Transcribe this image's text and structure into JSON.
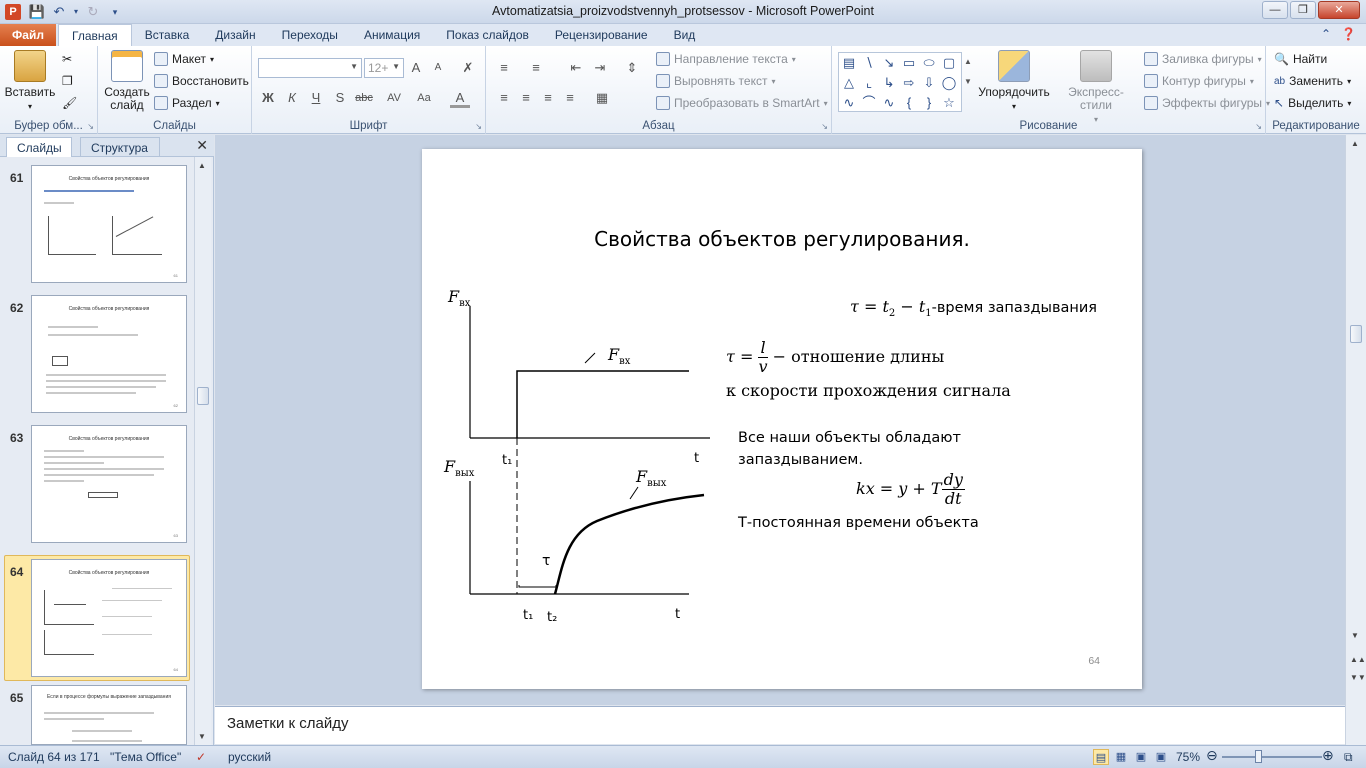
{
  "window": {
    "app_icon": "P",
    "title": "Avtomatizatsia_proizvodstvennyh_protsessov  -  Microsoft PowerPoint",
    "controls": [
      "minimize-icon",
      "restore-icon",
      "close-icon"
    ]
  },
  "ribbon_tabs": {
    "file": "Файл",
    "tabs": [
      "Главная",
      "Вставка",
      "Дизайн",
      "Переходы",
      "Анимация",
      "Показ слайдов",
      "Рецензирование",
      "Вид"
    ],
    "active": "Главная"
  },
  "ribbon": {
    "clipboard": {
      "paste": "Вставить",
      "label": "Буфер обм..."
    },
    "slides": {
      "new_slide": "Создать слайд",
      "layout": "Макет",
      "reset": "Восстановить",
      "section": "Раздел",
      "label": "Слайды"
    },
    "font": {
      "font_name": "",
      "font_size": "12+",
      "bold": "Ж",
      "italic": "К",
      "underline": "Ч",
      "shadow": "S",
      "strike": "abc",
      "spacing": "AV",
      "case": "Aa",
      "color": "A",
      "grow": "A",
      "shrink": "A",
      "label": "Шрифт"
    },
    "paragraph": {
      "text_direction": "Направление текста",
      "align_text": "Выровнять текст",
      "smartart": "Преобразовать в SmartArt",
      "label": "Абзац"
    },
    "drawing": {
      "arrange": "Упорядочить",
      "quick_styles": "Экспресс-стили",
      "fill": "Заливка фигуры",
      "outline": "Контур фигуры",
      "effects": "Эффекты фигуры",
      "label": "Рисование"
    },
    "editing": {
      "find": "Найти",
      "replace": "Заменить",
      "select": "Выделить",
      "label": "Редактирование"
    }
  },
  "left_pane": {
    "tabs": [
      "Слайды",
      "Структура"
    ],
    "active_tab": "Слайды",
    "thumbnails": [
      {
        "number": "61",
        "title": "Свойства объектов регулирования"
      },
      {
        "number": "62",
        "title": "Свойства объектов регулирования"
      },
      {
        "number": "63",
        "title": "Свойства объектов регулирования"
      },
      {
        "number": "64",
        "title": "Свойства объектов регулирования"
      },
      {
        "number": "65",
        "title": "Если в процессе формулы выражение запаздывания"
      }
    ],
    "selected": "64"
  },
  "slide": {
    "title": "Свойства объектов регулирования.",
    "graph_labels": {
      "f_in_axis": "F",
      "f_in_sub": "вх",
      "f_in_curve": "F",
      "f_in_curve_sub": "вх",
      "f_out_axis": "F",
      "f_out_sub": "вых",
      "f_out_curve": "F",
      "f_out_curve_sub": "вых",
      "t1_top": "t₁",
      "t_top": "t",
      "tau": "τ",
      "t1_bottom": "t₁",
      "t2_bottom": "t₂",
      "t_bottom": "t"
    },
    "formula1_text": "-время запаздывания",
    "formula2_text": "отношение длины",
    "formula2_line2": "к скорости прохождения сигнала",
    "text_delay_1": "Все наши объекты обладают",
    "text_delay_2": "запаздыванием.",
    "text_constant": "Т-постоянная времени объекта",
    "page_number": "64"
  },
  "notes": {
    "placeholder": "Заметки к слайду"
  },
  "status": {
    "slide_info": "Слайд 64 из 171",
    "theme": "\"Тема Office\"",
    "language": "русский",
    "zoom": "75%"
  }
}
